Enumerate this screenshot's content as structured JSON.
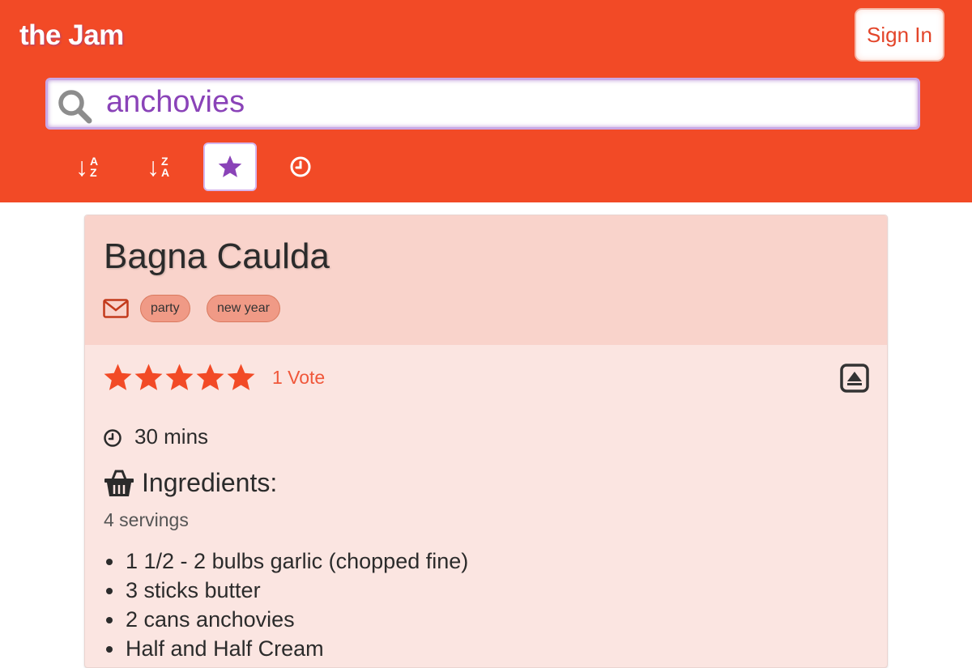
{
  "header": {
    "brand": "the Jam",
    "sign_in_label": "Sign In",
    "brand_color": "#f24a26",
    "accent_color": "#8a43b8"
  },
  "search": {
    "value": "anchovies",
    "icon": "search-icon"
  },
  "sort_options": [
    {
      "name": "sort-a-z",
      "arrow": "↓",
      "top": "A",
      "bottom": "Z",
      "active": false
    },
    {
      "name": "sort-z-a",
      "arrow": "↓",
      "top": "Z",
      "bottom": "A",
      "active": false
    },
    {
      "name": "sort-by-rating",
      "icon": "star-icon",
      "active": true
    },
    {
      "name": "sort-by-time",
      "icon": "clock-icon",
      "active": false
    }
  ],
  "recipe": {
    "title": "Bagna Caulda",
    "tags": [
      "party",
      "new year"
    ],
    "rating": 5,
    "votes_label": "1 Vote",
    "time_label": "30 mins",
    "ingredients_heading": "Ingredients:",
    "servings_label": "4 servings",
    "ingredients": [
      "1 1/2 - 2 bulbs garlic (chopped fine)",
      "3 sticks butter",
      "2 cans anchovies",
      "Half and Half Cream"
    ]
  }
}
